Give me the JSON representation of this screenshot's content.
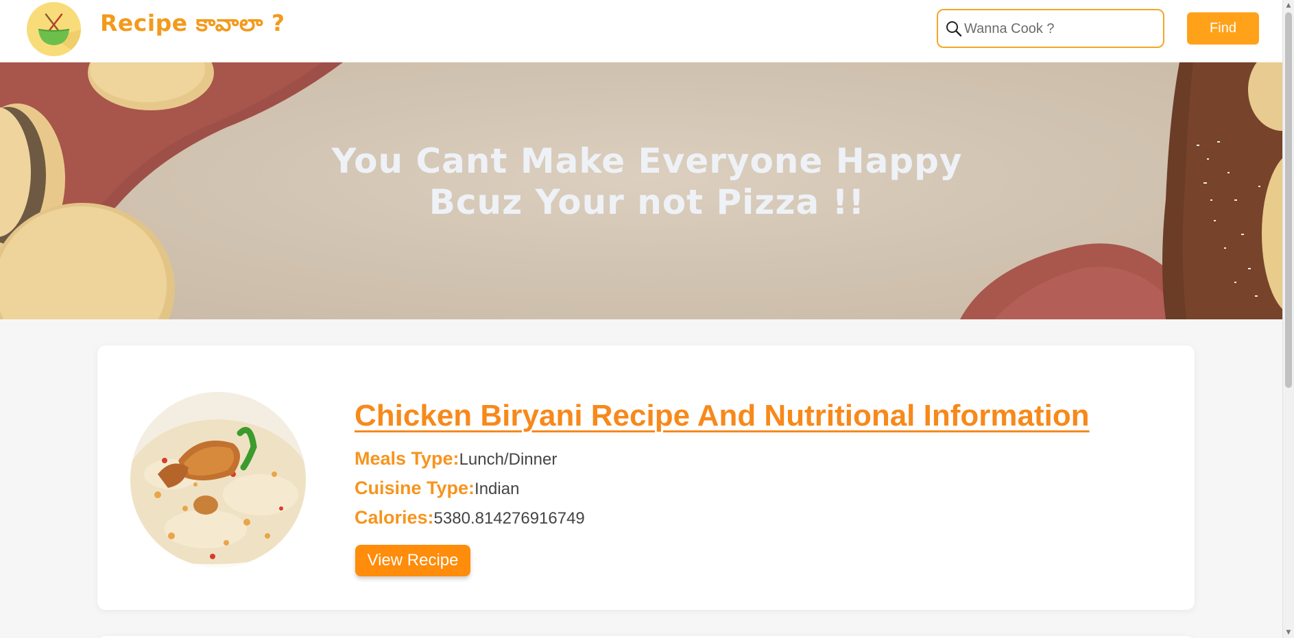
{
  "header": {
    "brand": "Recipe కావాలా ?",
    "logo_icon": "bowl-chopsticks-icon",
    "search_icon": "search-icon",
    "search": {
      "placeholder": "Wanna Cook ?",
      "value": ""
    },
    "find_label": "Find"
  },
  "hero": {
    "line1": "You Cant Make Everyone Happy",
    "line2": "Bcuz Your not Pizza !!"
  },
  "recipes": [
    {
      "title": "Chicken Biryani Recipe And Nutritional Information",
      "image": "chicken-biryani",
      "meals_label": "Meals Type:",
      "meals_value": "Lunch/Dinner",
      "cuisine_label": "Cuisine Type:",
      "cuisine_value": "Indian",
      "calories_label": "Calories:",
      "calories_value": "5380.814276916749",
      "button_label": "View Recipe"
    }
  ],
  "colors": {
    "accent": "#f7891b",
    "button": "#ff8c0a",
    "find_button": "#ffa21a",
    "logo_bg": "#f9dc7a",
    "hero_text": "#eef2f7"
  }
}
